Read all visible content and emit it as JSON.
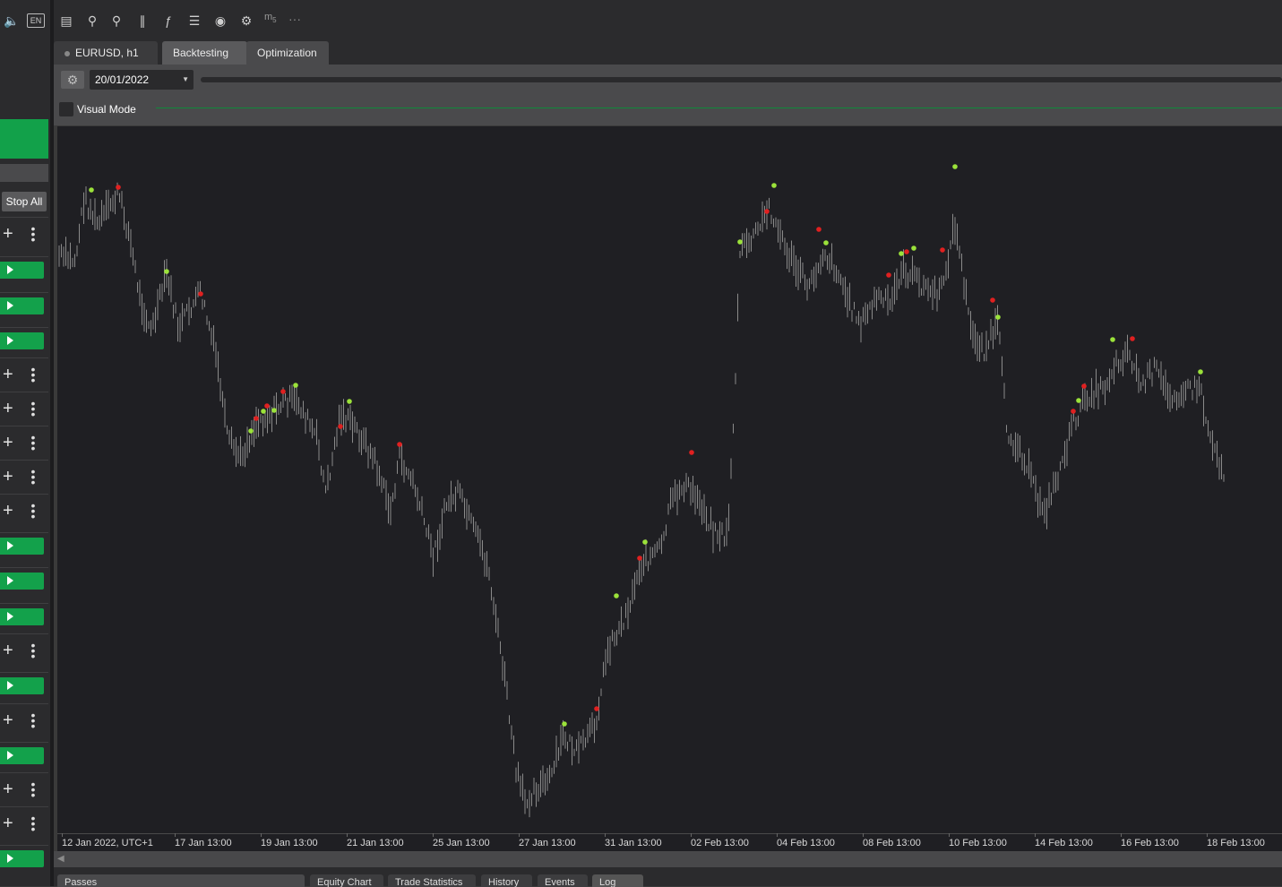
{
  "toolbar": {
    "lang_badge": "EN",
    "more_label": "···",
    "m5_label": "m",
    "m5_sub": "5"
  },
  "tabs": [
    {
      "label": "EURUSD, h1"
    },
    {
      "label": "Backtesting"
    },
    {
      "label": "Optimization"
    }
  ],
  "settings": {
    "date_value": "20/01/2022",
    "visual_mode_label": "Visual Mode"
  },
  "left_panel": {
    "stop_all_label": "Stop All",
    "rows": [
      "plus",
      "play",
      "play",
      "play",
      "plus",
      "plus",
      "plus",
      "plus",
      "plus",
      "play",
      "play",
      "play",
      "plus",
      "play",
      "plus",
      "play",
      "plus",
      "plus",
      "play"
    ]
  },
  "bottom_tabs": [
    {
      "label": "Passes"
    },
    {
      "label": "Equity Chart"
    },
    {
      "label": "Trade Statistics"
    },
    {
      "label": "History"
    },
    {
      "label": "Events"
    },
    {
      "label": "Log"
    }
  ],
  "chart_data": {
    "type": "bar",
    "symbol": "EURUSD",
    "timeframe": "h1",
    "x_tick_labels": [
      "12 Jan 2022, UTC+1",
      "17 Jan 13:00",
      "19 Jan 13:00",
      "21 Jan 13:00",
      "25 Jan 13:00",
      "27 Jan 13:00",
      "31 Jan 13:00",
      "02 Feb 13:00",
      "04 Feb 13:00",
      "08 Feb 13:00",
      "10 Feb 13:00",
      "14 Feb 13:00",
      "16 Feb 13:00",
      "18 Feb 13:00"
    ],
    "colors": {
      "bars": "#8a8a8a",
      "buy_marker": "#9be23a",
      "sell_marker": "#e02020",
      "background": "#1f1f23"
    }
  }
}
